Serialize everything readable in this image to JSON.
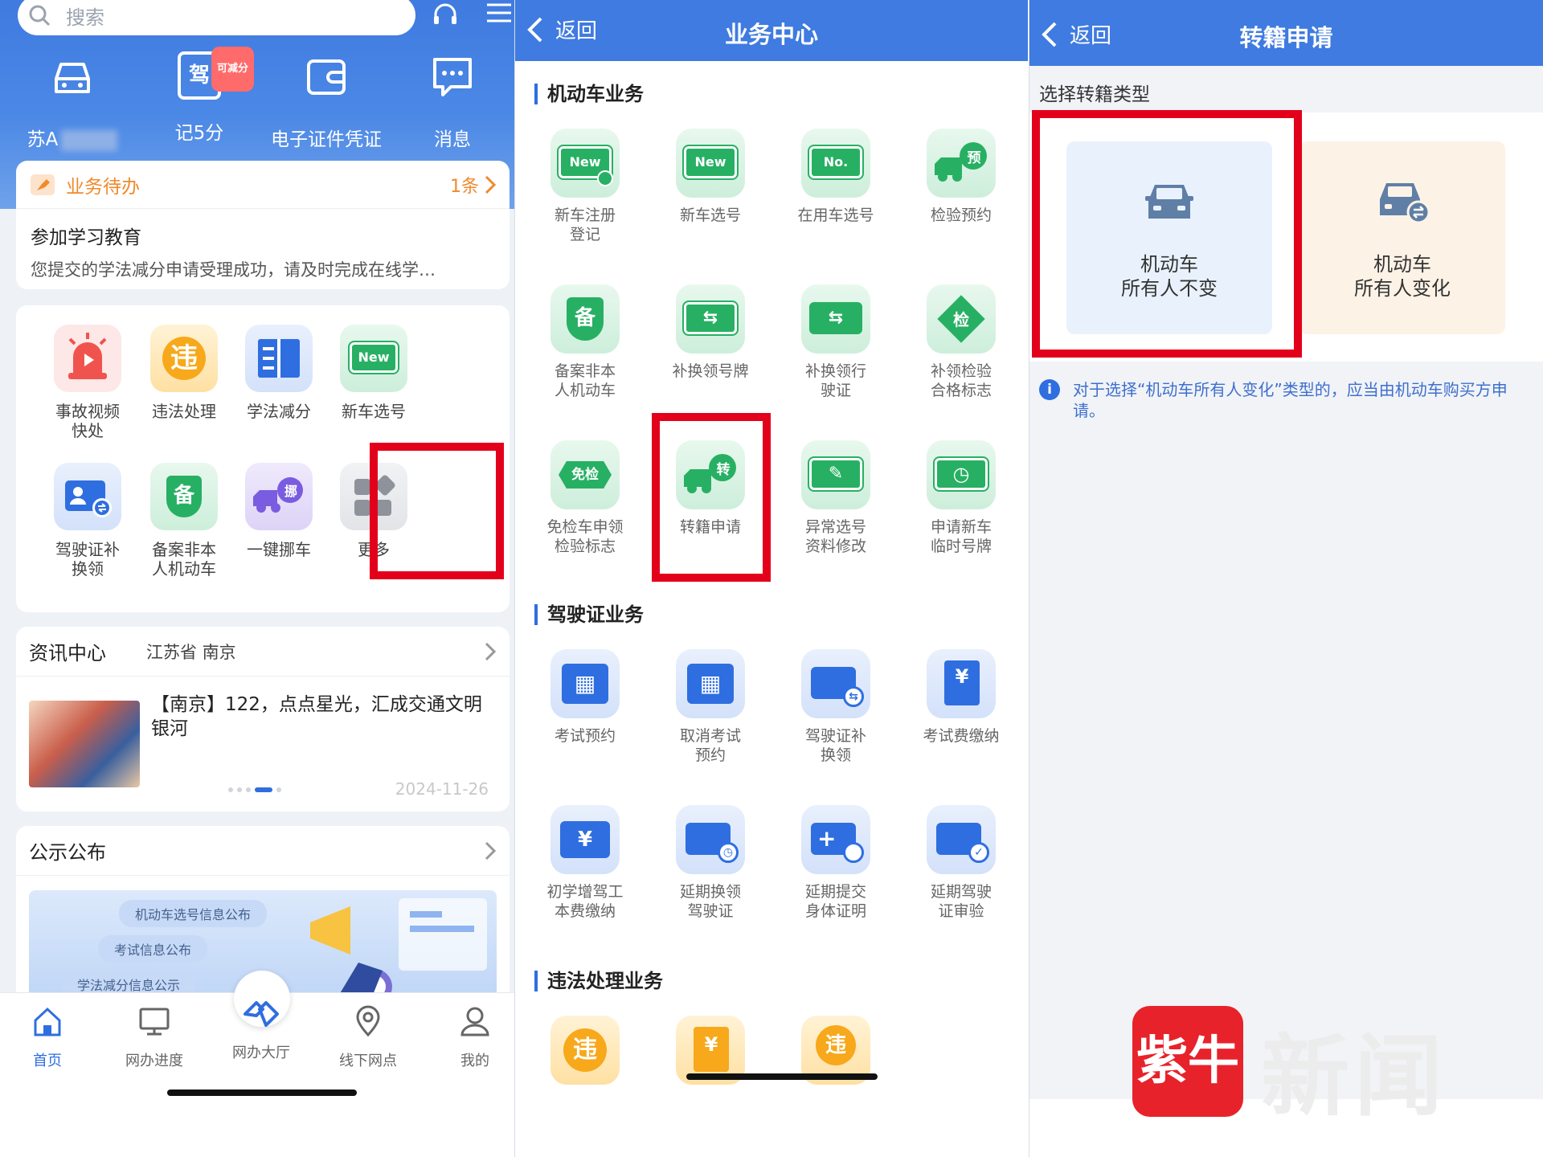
{
  "panel1": {
    "search_placeholder": "搜索",
    "quick": [
      {
        "label": "苏A",
        "icon": "car-icon"
      },
      {
        "label": "记5分",
        "icon": "license-icon",
        "badge": "可减分",
        "icon_text": "驾"
      },
      {
        "label": "电子证件凭证",
        "icon": "wallet-icon"
      },
      {
        "label": "消息",
        "icon": "message-icon"
      }
    ],
    "todo": {
      "title": "业务待办",
      "count": "1条",
      "item_title": "参加学习教育",
      "item_desc": "您提交的学法减分申请受理成功，请及时完成在线学…"
    },
    "services": [
      {
        "label": "事故视频\n快处",
        "icon": "alarm-icon"
      },
      {
        "label": "违法处理",
        "icon": "violation-icon",
        "icon_text": "违"
      },
      {
        "label": "学法减分",
        "icon": "book-icon"
      },
      {
        "label": "新车选号",
        "icon": "new-plate-icon",
        "icon_text": "New"
      },
      {
        "label": "驾驶证补\n换领",
        "icon": "license-swap-icon"
      },
      {
        "label": "备案非本\n人机动车",
        "icon": "shield-icon",
        "icon_text": "备"
      },
      {
        "label": "一键挪车",
        "icon": "move-car-icon",
        "icon_text": "挪"
      },
      {
        "label": "更多",
        "icon": "more-icon"
      }
    ],
    "news": {
      "title": "资讯中心",
      "location": "江苏省 南京",
      "headline": "【南京】122，点点星光，汇成交通文明银河",
      "date": "2024-11-26"
    },
    "notice": {
      "title": "公示公布",
      "pills": [
        "机动车选号信息公布",
        "考试信息公布",
        "学法减分信息公示"
      ]
    },
    "tabs": [
      {
        "label": "首页",
        "icon": "home-icon"
      },
      {
        "label": "网办进度",
        "icon": "monitor-icon"
      },
      {
        "label": "网办大厅",
        "icon": "handshake-icon"
      },
      {
        "label": "线下网点",
        "icon": "location-icon"
      },
      {
        "label": "我的",
        "icon": "user-icon"
      }
    ]
  },
  "panel2": {
    "back": "返回",
    "title": "业务中心",
    "sections": [
      {
        "title": "机动车业务",
        "items": [
          {
            "label": "新车注册\n登记",
            "icon_text": "New"
          },
          {
            "label": "新车选号",
            "icon_text": "New"
          },
          {
            "label": "在用车选号",
            "icon_text": "No."
          },
          {
            "label": "检验预约",
            "icon_text": "预"
          },
          {
            "label": "备案非本\n人机动车",
            "icon_text": "备"
          },
          {
            "label": "补换领号牌",
            "icon_text": "⇆"
          },
          {
            "label": "补换领行\n驶证",
            "icon_text": "⇆"
          },
          {
            "label": "补领检验\n合格标志",
            "icon_text": "检"
          },
          {
            "label": "免检车申领\n检验标志",
            "icon_text": "免检"
          },
          {
            "label": "转籍申请",
            "icon_text": "转"
          },
          {
            "label": "异常选号\n资料修改",
            "icon_text": "✎"
          },
          {
            "label": "申请新车\n临时号牌",
            "icon_text": "◷"
          }
        ]
      },
      {
        "title": "驾驶证业务",
        "items": [
          {
            "label": "考试预约",
            "icon_text": "▦"
          },
          {
            "label": "取消考试\n预约",
            "icon_text": "▦"
          },
          {
            "label": "驾驶证补\n换领",
            "icon_text": "⇆"
          },
          {
            "label": "考试费缴纳",
            "icon_text": "¥"
          },
          {
            "label": "初学增驾工\n本费缴纳",
            "icon_text": "¥"
          },
          {
            "label": "延期换领\n驾驶证",
            "icon_text": "◷"
          },
          {
            "label": "延期提交\n身体证明",
            "icon_text": "+"
          },
          {
            "label": "延期驾驶\n证审验",
            "icon_text": "✓"
          }
        ]
      },
      {
        "title": "违法处理业务",
        "items": [
          {
            "label": "",
            "icon_text": "违"
          },
          {
            "label": "",
            "icon_text": "¥"
          },
          {
            "label": "",
            "icon_text": "违"
          }
        ]
      }
    ]
  },
  "panel3": {
    "back": "返回",
    "title": "转籍申请",
    "choose_label": "选择转籍类型",
    "types": [
      {
        "label": "机动车\n所有人不变",
        "icon": "car-icon"
      },
      {
        "label": "机动车\n所有人变化",
        "icon": "car-swap-icon"
      }
    ],
    "hint": "对于选择“机动车所有人变化”类型的，应当由机动车购买方申请。",
    "info_icon": "i",
    "logo_glyph": "紫牛",
    "logo_text": "新闻"
  },
  "colors": {
    "primary": "#3f7be0",
    "highlight": "#e3001b",
    "orange": "#f08a2c"
  }
}
